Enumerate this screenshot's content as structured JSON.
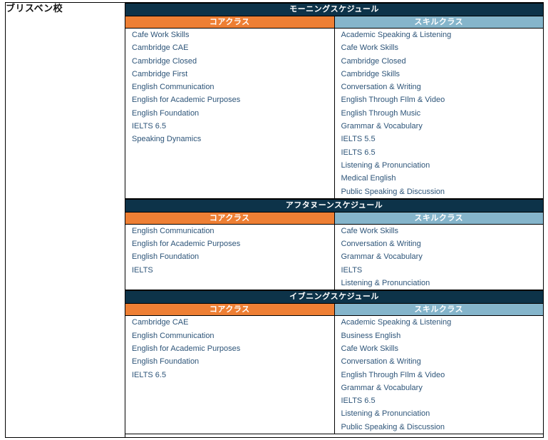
{
  "campus": {
    "name": "ブリスベン校"
  },
  "colors": {
    "session_header_bg": "#0D3349",
    "core_header_bg": "#EE7F34",
    "skill_header_bg": "#85B5CB",
    "class_text": "#2E5579",
    "header_text": "#FFFFFF",
    "border": "#000000",
    "page_bg": "#FFFFFF"
  },
  "column_headers": {
    "core": "コアクラス",
    "skill": "スキルクラス"
  },
  "sessions": [
    {
      "id": "morning",
      "title": "モーニングスケジュール",
      "core": [
        "Cafe Work Skills",
        "Cambridge CAE",
        "Cambridge Closed",
        "Cambridge First",
        "English Communication",
        "English for Academic Purposes",
        "English Foundation",
        "IELTS 6.5",
        "Speaking Dynamics"
      ],
      "skill": [
        "Academic Speaking & Listening",
        "Cafe Work Skills",
        "Cambridge Closed",
        "Cambridge Skills",
        "Conversation & Writing",
        "English Through FIlm & Video",
        "English Through Music",
        "Grammar & Vocabulary",
        "IELTS 5.5",
        "IELTS 6.5",
        "Listening & Pronunciation",
        "Medical English",
        "Public Speaking & Discussion"
      ]
    },
    {
      "id": "afternoon",
      "title": "アフタヌーンスケジュール",
      "core": [
        "English Communication",
        "English for Academic Purposes",
        "English Foundation",
        "IELTS"
      ],
      "skill": [
        "Cafe Work Skills",
        "Conversation & Writing",
        "Grammar & Vocabulary",
        "IELTS",
        "Listening & Pronunciation"
      ]
    },
    {
      "id": "evening",
      "title": "イブニングスケジュール",
      "core": [
        "Cambridge CAE",
        "English Communication",
        "English for Academic Purposes",
        "English Foundation",
        "IELTS 6.5"
      ],
      "skill": [
        "Academic Speaking & Listening",
        "Business English",
        "Cafe Work Skills",
        "Conversation & Writing",
        "English Through FIlm & Video",
        "Grammar & Vocabulary",
        "IELTS 6.5",
        "Listening & Pronunciation",
        "Public Speaking & Discussion"
      ]
    }
  ]
}
